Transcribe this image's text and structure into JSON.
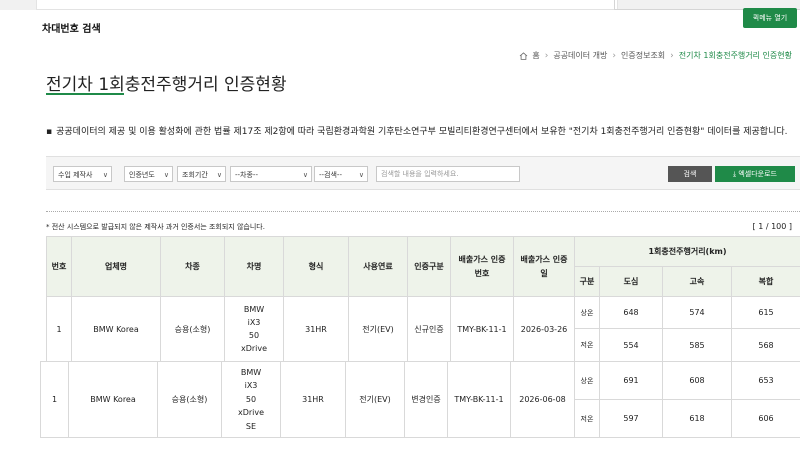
{
  "header": {
    "section_label": "차대번호 검색",
    "quick_button": "퀵메뉴 열기"
  },
  "breadcrumb": {
    "items": [
      "홈",
      "공공데이터 개방",
      "인증정보조회"
    ],
    "current": "전기차 1회충전주행거리 인증현황"
  },
  "page": {
    "title": "전기차 1회충전주행거리 인증현황",
    "description": "공공데이터의 제공 및 이용 활성화에 관한 법률 제17조 제2항에 따라 국립환경과학원 기후탄소연구부 모빌리티환경연구센터에서 보유한 \"전기차 1회충전주행거리 인증현황\" 데이터를 제공합니다."
  },
  "filters": {
    "import_type": "수입 제작사",
    "cert_year": "인증년도",
    "period": "조회기간",
    "vehicle_type": "--차종--",
    "search_field": "--검색--",
    "search_placeholder": "검색할 내용을 입력하세요.",
    "search_button": "검색",
    "excel_button": "엑셀다운로드"
  },
  "notice": "* 전산 시스템으로 발급되지 않은 제작사 과거 인증서는 조회되지 않습니다.",
  "pager": "[ 1 / 100 ]",
  "table": {
    "headers": {
      "no": "번호",
      "company": "업체명",
      "type": "차종",
      "model": "차명",
      "form": "형식",
      "fuel": "사용연료",
      "cert_type": "인증구분",
      "emission_no": "배출가스 인증번호",
      "emission_date": "배출가스 인증일",
      "range_group": "1회충전주행거리(km)",
      "division": "구분",
      "city": "도심",
      "highway": "고속",
      "combined": "복합"
    },
    "rows": [
      {
        "no": "1",
        "company": "BMW Korea",
        "type": "승용(소형)",
        "model_lines": [
          "BMW",
          "iX3",
          "50",
          "xDrive"
        ],
        "form": "31HR",
        "fuel": "전기(EV)",
        "cert_type": "신규인증",
        "emission_no": "TMY-BK-11-1",
        "emission_date": "2026-03-26",
        "ranges": [
          {
            "division": "상온",
            "city": "648",
            "highway": "574",
            "combined": "615"
          },
          {
            "division": "저온",
            "city": "554",
            "highway": "585",
            "combined": "568"
          }
        ]
      },
      {
        "no": "1",
        "company": "BMW Korea",
        "type": "승용(소형)",
        "model_lines": [
          "BMW",
          "iX3",
          "50",
          "xDrive",
          "SE"
        ],
        "form": "31HR",
        "fuel": "전기(EV)",
        "cert_type": "변경인증",
        "emission_no": "TMY-BK-11-1",
        "emission_date": "2026-06-08",
        "ranges": [
          {
            "division": "상온",
            "city": "691",
            "highway": "608",
            "combined": "653"
          },
          {
            "division": "저온",
            "city": "597",
            "highway": "618",
            "combined": "606"
          }
        ]
      }
    ]
  },
  "colors": {
    "accent": "#1f8a48",
    "header_bg": "#eef3ea",
    "border": "#d9d9d9"
  }
}
